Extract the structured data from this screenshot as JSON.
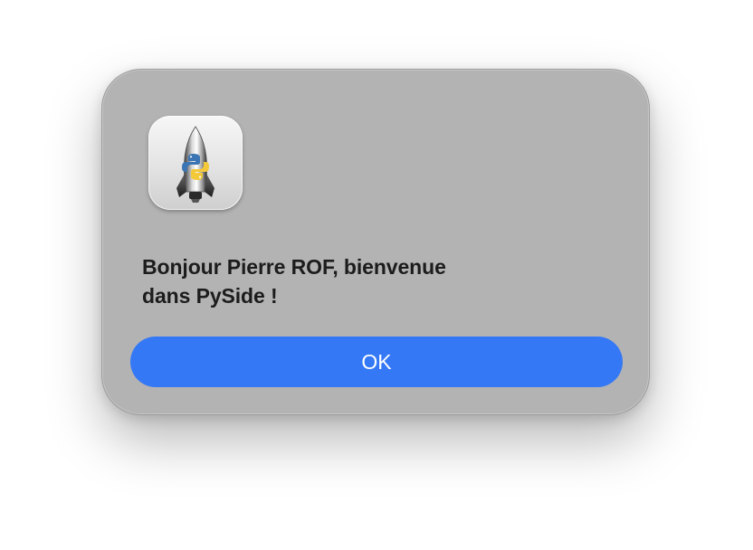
{
  "alert": {
    "icon": "python-launcher-rocket-icon",
    "message_line1": "Bonjour Pierre ROF, bienvenue",
    "message_line2": "dans PySide !",
    "ok_label": "OK"
  },
  "colors": {
    "dialog_background": "#b3b3b3",
    "button_background": "#3478f6",
    "button_text": "#ffffff",
    "message_text": "#1c1c1c"
  }
}
